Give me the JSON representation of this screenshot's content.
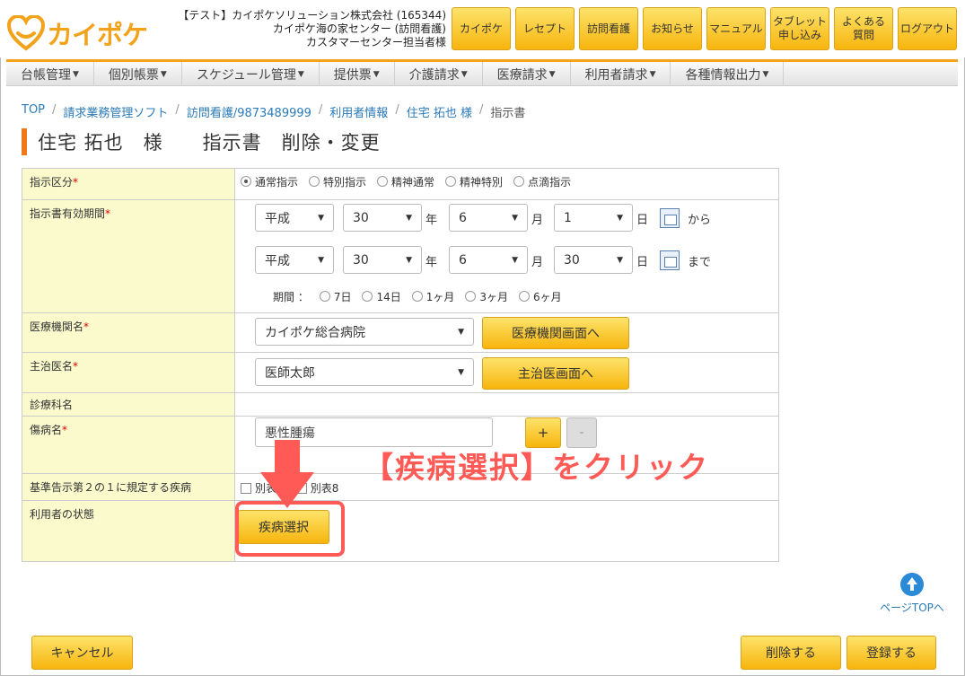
{
  "header": {
    "logo_text": "カイポケ",
    "company_lines": [
      "【テスト】カイポケソリューション株式会社 (165344)",
      "カイポケ海の家センター (訪問看護)",
      "カスタマーセンター担当者様"
    ],
    "nav": [
      "カイポケ",
      "レセプト",
      "訪問看護",
      "お知らせ",
      "マニュアル",
      "タブレット\n申し込み",
      "よくある\n質問",
      "ログアウト"
    ]
  },
  "menu": [
    "台帳管理",
    "個別帳票",
    "スケジュール管理",
    "提供票",
    "介護請求",
    "医療請求",
    "利用者請求",
    "各種情報出力"
  ],
  "breadcrumb": [
    "TOP",
    "請求業務管理ソフト",
    "訪問看護/9873489999",
    "利用者情報",
    "住宅 拓也 様",
    "指示書"
  ],
  "page_title": "住宅 拓也　様　　指示書　削除・変更",
  "form": {
    "instruction_type": {
      "label": "指示区分",
      "options": [
        "通常指示",
        "特別指示",
        "精神通常",
        "精神特別",
        "点滴指示"
      ],
      "selected": "通常指示"
    },
    "validity": {
      "label": "指示書有効期間",
      "from": {
        "era": "平成",
        "year": "30",
        "month": "6",
        "day": "1"
      },
      "to": {
        "era": "平成",
        "year": "30",
        "month": "6",
        "day": "30"
      },
      "unit_year": "年",
      "unit_month": "月",
      "unit_day": "日",
      "from_suffix": "から",
      "to_suffix": "まで",
      "period_label": "期間 ：",
      "period_options": [
        "7日",
        "14日",
        "1ヶ月",
        "3ヶ月",
        "6ヶ月"
      ]
    },
    "institution": {
      "label": "医療機関名",
      "value": "カイポケ総合病院",
      "button": "医療機関画面へ"
    },
    "doctor": {
      "label": "主治医名",
      "value": "医師太郎",
      "button": "主治医画面へ"
    },
    "department": {
      "label": "診療科名"
    },
    "disease": {
      "label": "傷病名",
      "value": "悪性腫瘍",
      "plus": "+",
      "minus": "-"
    },
    "standard_disease": {
      "label": "基準告示第２の１に規定する疾病",
      "options": [
        "別表7",
        "別表8"
      ]
    },
    "condition": {
      "label": "利用者の状態",
      "button": "疾病選択"
    }
  },
  "annotation": "【疾病選択】をクリック",
  "pagetop": "ページTOPへ",
  "footer": {
    "cancel": "キャンセル",
    "delete": "削除する",
    "register": "登録する"
  },
  "colors": {
    "accent": "#f3a21b",
    "annotation": "#ff5a55",
    "label_bg": "#fafacd",
    "link": "#2a7ab8"
  }
}
